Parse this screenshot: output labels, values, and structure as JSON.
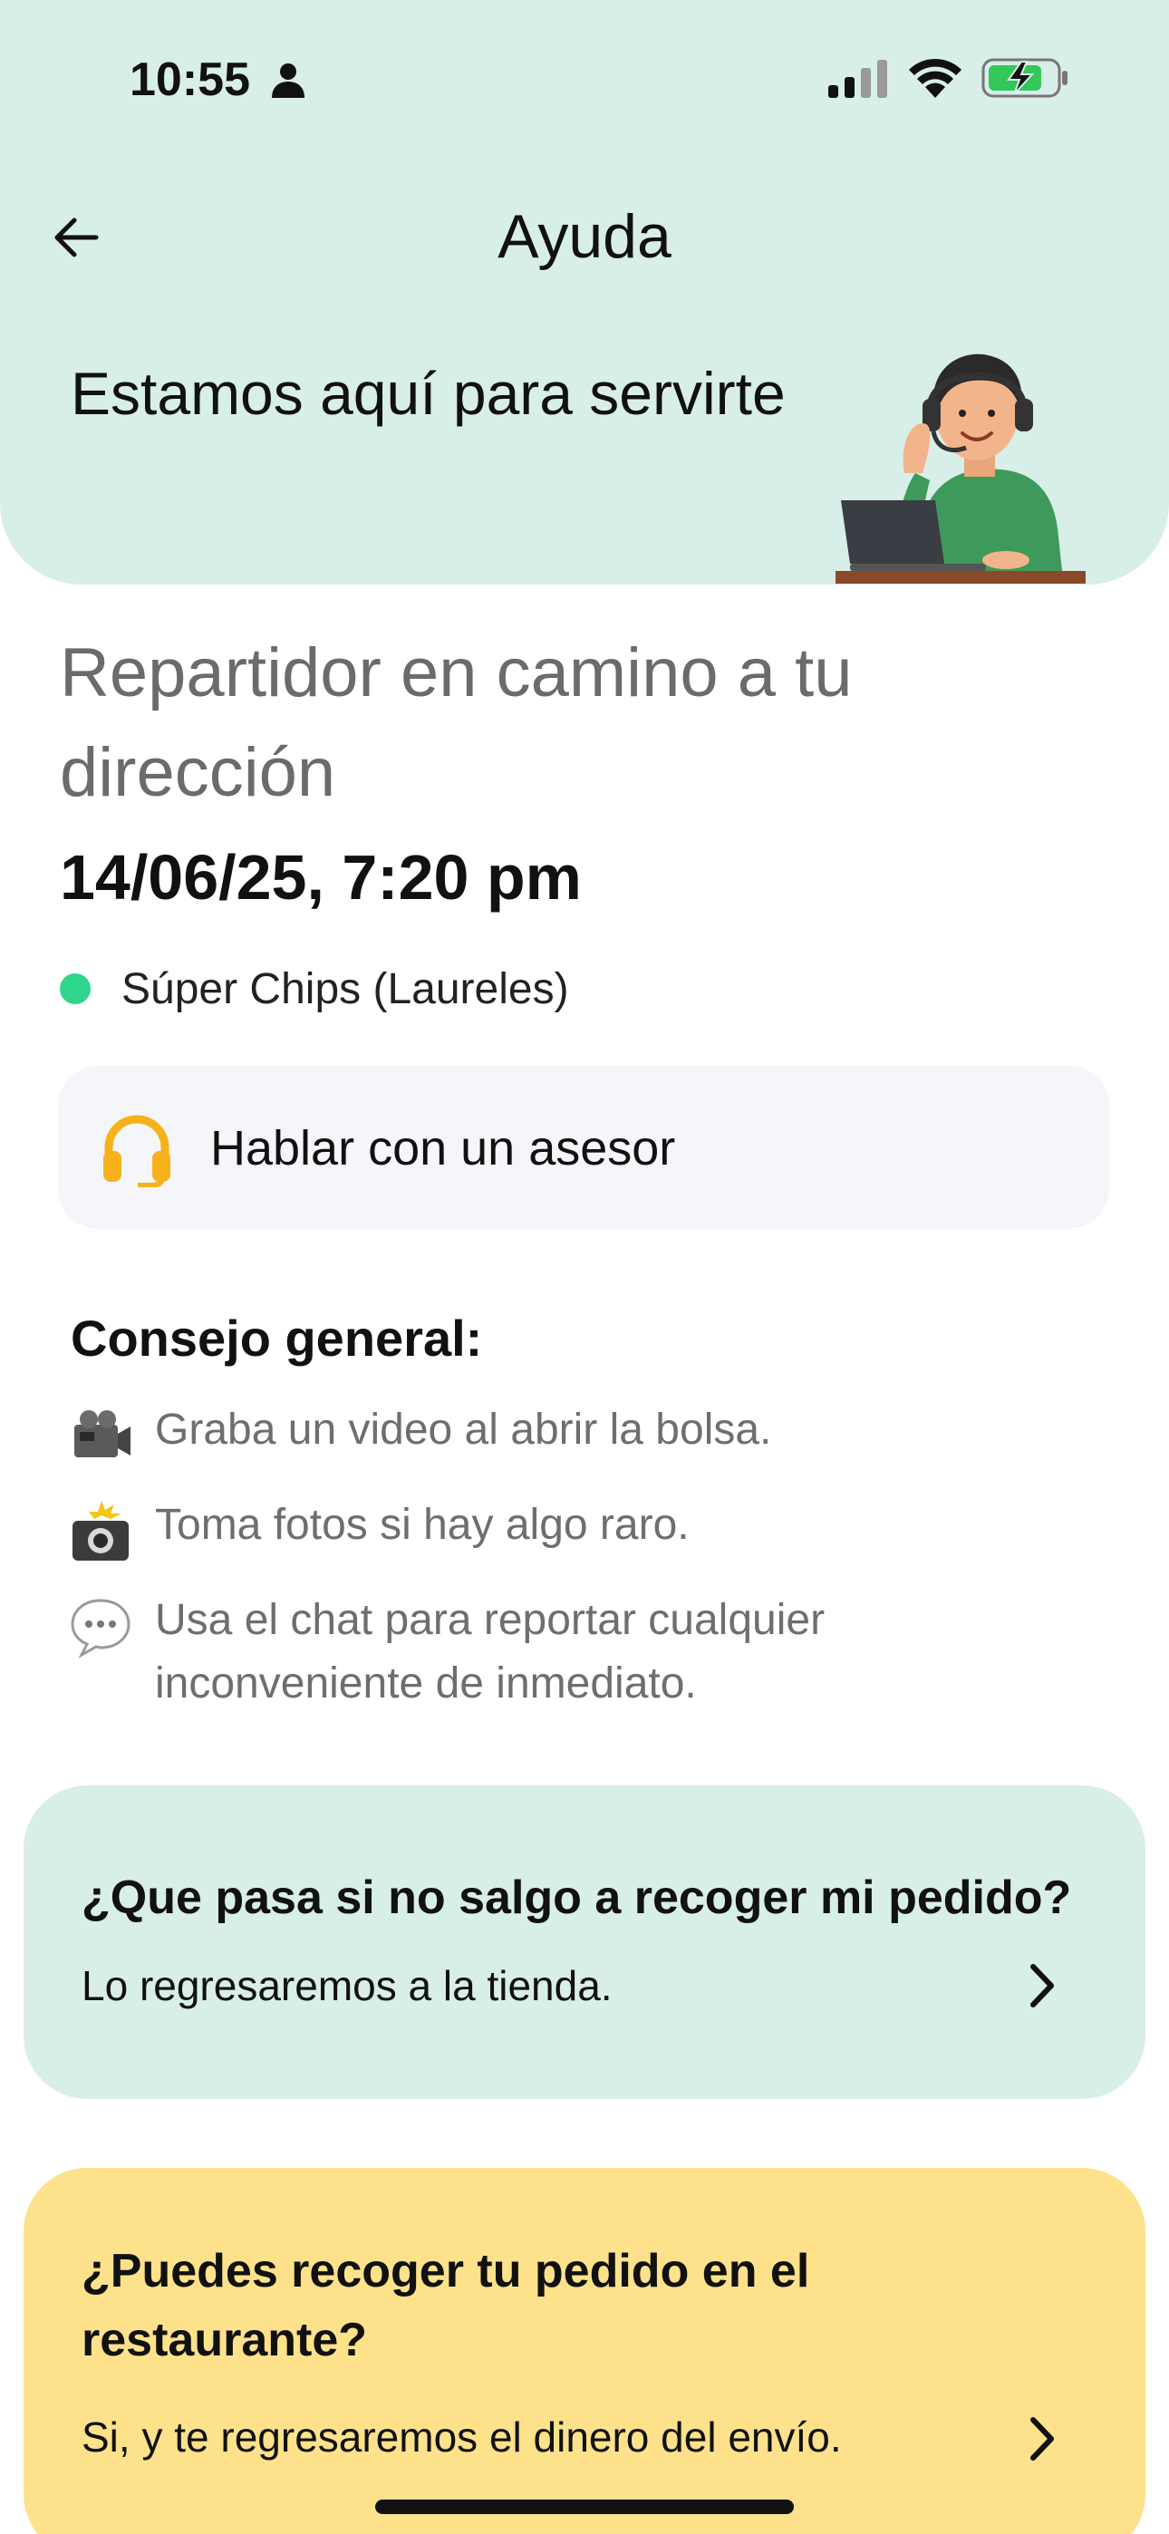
{
  "status_bar": {
    "time": "10:55",
    "icons": [
      "person-icon",
      "signal-icon",
      "wifi-icon",
      "battery-charging-icon"
    ]
  },
  "nav": {
    "back_icon": "arrow-left-icon",
    "title": "Ayuda"
  },
  "hero": {
    "title": "Estamos aquí para servirte",
    "illustration": "support-agent-illustration"
  },
  "order": {
    "status": "Repartidor en camino a tu dirección",
    "date": "14/06/25, 7:20 pm",
    "store": "Súper Chips (Laureles)",
    "store_dot_color": "#2fd58a"
  },
  "advisor": {
    "icon": "headphones-icon",
    "label": "Hablar con un asesor",
    "icon_color": "#f7b21b"
  },
  "tips": {
    "title": "Consejo general:",
    "items": [
      {
        "icon": "video-camera-icon",
        "text": "Graba un video al abrir la bolsa."
      },
      {
        "icon": "camera-flash-icon",
        "text": "Toma fotos si hay algo raro."
      },
      {
        "icon": "speech-bubble-icon",
        "text": "Usa el chat para reportar cualquier inconveniente de inmediato."
      }
    ]
  },
  "faq": [
    {
      "question": "¿Que pasa si no salgo a recoger mi pedido?",
      "answer": "Lo regresaremos a la tienda.",
      "color": "#d8eee8"
    },
    {
      "question": "¿Puedes recoger tu pedido en el restaurante?",
      "answer": "Si, y te regresaremos el dinero del envío.",
      "color": "#fde28b"
    }
  ],
  "colors": {
    "header_bg": "#d8eee8",
    "text_primary": "#111111",
    "text_muted": "#6e6e6e",
    "advisor_bg": "#f4f6f9"
  }
}
